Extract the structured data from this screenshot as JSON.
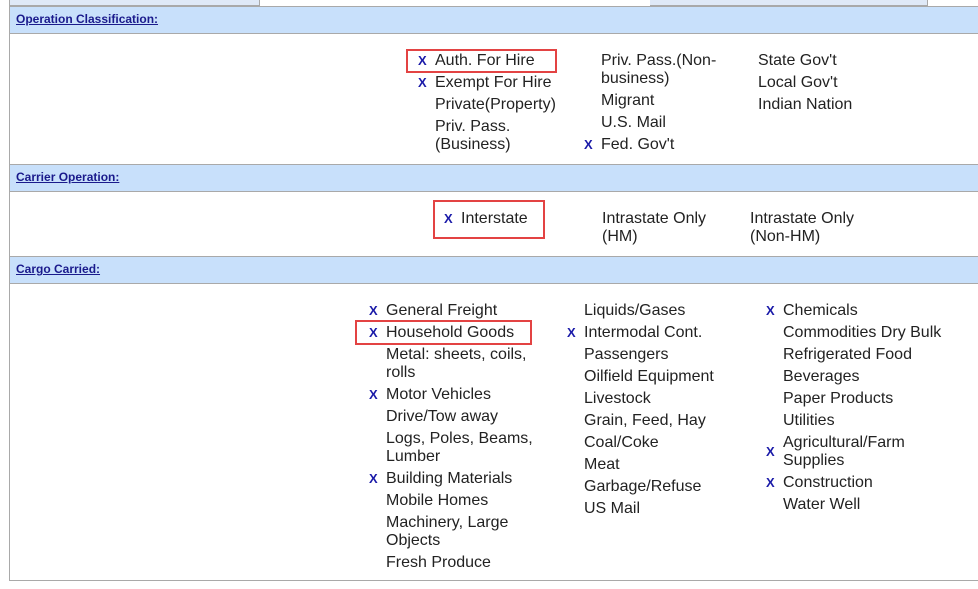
{
  "mark_glyph": "X",
  "highlight_color": "#e34343",
  "sections": [
    {
      "title": "Operation Classification:",
      "columns": [
        [
          {
            "label": "Auth. For Hire",
            "checked": true
          },
          {
            "label": "Exempt For Hire",
            "checked": true
          },
          {
            "label": "Private(Property)",
            "checked": false
          },
          {
            "label": "Priv. Pass. (Business)",
            "checked": false
          }
        ],
        [
          {
            "label": "Priv. Pass.(Non-business)",
            "checked": false
          },
          {
            "label": "Migrant",
            "checked": false
          },
          {
            "label": "U.S. Mail",
            "checked": false
          },
          {
            "label": "Fed. Gov't",
            "checked": true
          }
        ],
        [
          {
            "label": "State Gov't",
            "checked": false
          },
          {
            "label": "Local Gov't",
            "checked": false
          },
          {
            "label": "Indian Nation",
            "checked": false
          }
        ]
      ]
    },
    {
      "title": "Carrier Operation:",
      "columns": [
        [
          {
            "label": "Interstate",
            "checked": true
          }
        ],
        [
          {
            "label": "Intrastate Only (HM)",
            "checked": false
          }
        ],
        [
          {
            "label": "Intrastate Only (Non-HM)",
            "checked": false
          }
        ]
      ]
    },
    {
      "title": "Cargo Carried:",
      "columns": [
        [
          {
            "label": "General Freight",
            "checked": true
          },
          {
            "label": "Household Goods",
            "checked": true
          },
          {
            "label": "Metal: sheets, coils, rolls",
            "checked": false
          },
          {
            "label": "Motor Vehicles",
            "checked": true
          },
          {
            "label": "Drive/Tow away",
            "checked": false
          },
          {
            "label": "Logs, Poles, Beams, Lumber",
            "checked": false
          },
          {
            "label": "Building Materials",
            "checked": true
          },
          {
            "label": "Mobile Homes",
            "checked": false
          },
          {
            "label": "Machinery, Large Objects",
            "checked": false
          },
          {
            "label": "Fresh Produce",
            "checked": false
          }
        ],
        [
          {
            "label": "Liquids/Gases",
            "checked": false
          },
          {
            "label": "Intermodal Cont.",
            "checked": true
          },
          {
            "label": "Passengers",
            "checked": false
          },
          {
            "label": "Oilfield Equipment",
            "checked": false
          },
          {
            "label": "Livestock",
            "checked": false
          },
          {
            "label": "Grain, Feed, Hay",
            "checked": false
          },
          {
            "label": "Coal/Coke",
            "checked": false
          },
          {
            "label": "Meat",
            "checked": false
          },
          {
            "label": "Garbage/Refuse",
            "checked": false
          },
          {
            "label": "US Mail",
            "checked": false
          }
        ],
        [
          {
            "label": "Chemicals",
            "checked": true
          },
          {
            "label": "Commodities Dry Bulk",
            "checked": false
          },
          {
            "label": "Refrigerated Food",
            "checked": false
          },
          {
            "label": "Beverages",
            "checked": false
          },
          {
            "label": "Paper Products",
            "checked": false
          },
          {
            "label": "Utilities",
            "checked": false
          },
          {
            "label": "Agricultural/Farm Supplies",
            "checked": true
          },
          {
            "label": "Construction",
            "checked": true
          },
          {
            "label": "Water Well",
            "checked": false
          }
        ]
      ]
    }
  ]
}
